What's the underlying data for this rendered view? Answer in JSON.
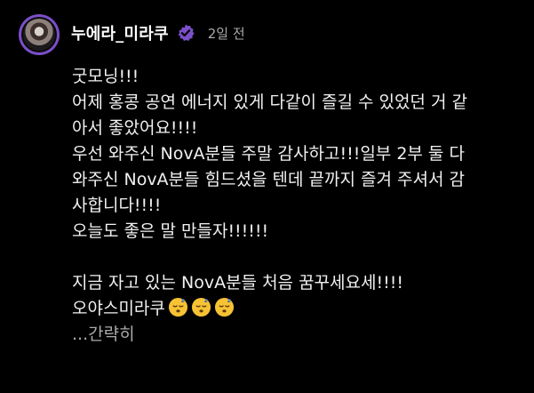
{
  "post": {
    "username": "누에라_미라쿠",
    "verified_icon": "verified-badge-icon",
    "time_ago": "2일 전",
    "lines": [
      "굿모닝!!!",
      "어제 홍콩 공연 에너지 있게 다같이 즐길 수 있었던 거 같",
      "아서 좋았어요!!!!",
      "우선 와주신 NovA분들 주말 감사하고!!!일부 2부 둘 다",
      "와주신 NovA분들 힘드셨을 텐데 끝까지 즐겨 주셔서 감",
      "사합니다!!!!",
      "오늘도 좋은 말 만들자!!!!!!"
    ],
    "lines2": [
      "지금 자고 있는 NovA분들 처음 꿈꾸세요세!!!!",
      "오야스미라쿠"
    ],
    "emoji_icon": "sleeping-face-emoji",
    "emoji_count": 3,
    "more_label": "...간략히"
  },
  "colors": {
    "background": "#000000",
    "text": "#f1f1f1",
    "muted": "#aaaaaa",
    "verified": "#7b4fc9"
  }
}
